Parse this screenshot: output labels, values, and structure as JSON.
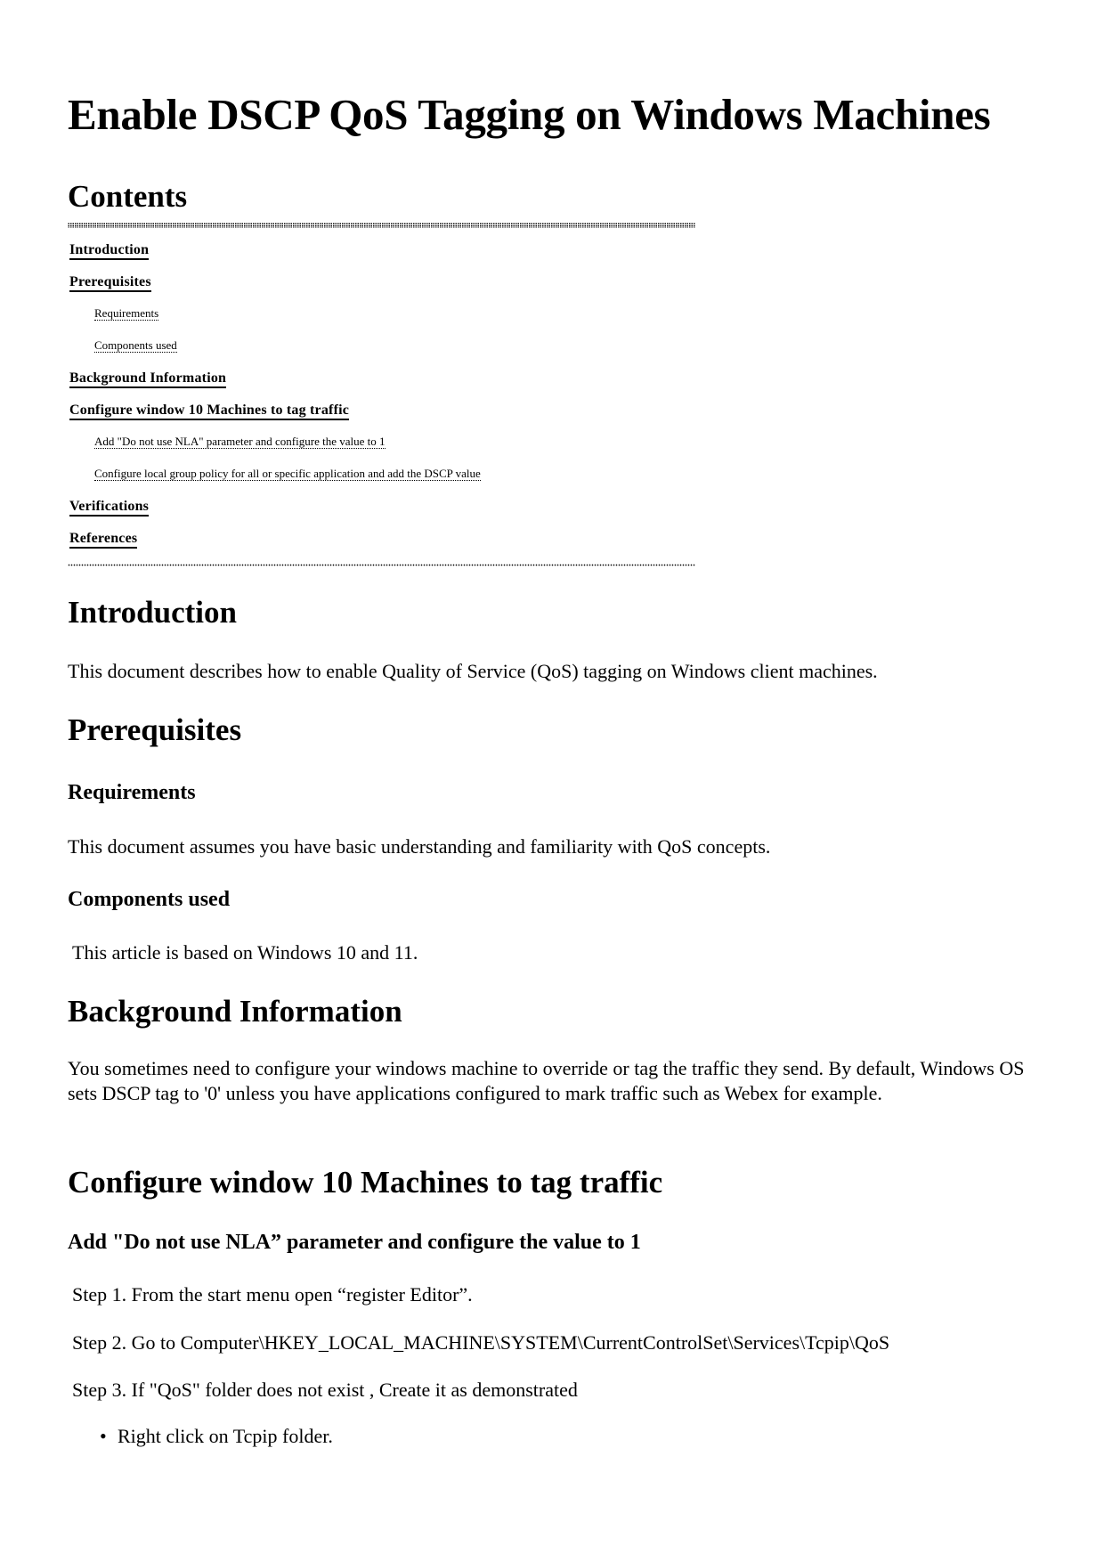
{
  "title": "Enable DSCP QoS Tagging on Windows Machines",
  "contents": {
    "heading": "Contents",
    "items": [
      {
        "label": "Introduction",
        "level": 1
      },
      {
        "label": "Prerequisites",
        "level": 1
      },
      {
        "label": "Requirements",
        "level": 2
      },
      {
        "label": "Components used",
        "level": 2
      },
      {
        "label": "Background Information",
        "level": 1
      },
      {
        "label": "Configure window 10 Machines to tag traffic",
        "level": 1
      },
      {
        "label": "Add \"Do not use NLA\" parameter and configure the value to 1",
        "level": 2
      },
      {
        "label": "Configure local group policy for all or specific application and add the DSCP value",
        "level": 2
      },
      {
        "label": "Verifications",
        "level": 1
      },
      {
        "label": "References",
        "level": 1
      }
    ]
  },
  "sections": {
    "introduction": {
      "heading": "Introduction",
      "body": "This document describes how to enable Quality of Service (QoS) tagging on Windows client machines."
    },
    "prerequisites": {
      "heading": "Prerequisites",
      "requirements": {
        "heading": "Requirements",
        "body": "This document assumes you have basic understanding and familiarity with QoS concepts."
      },
      "components": {
        "heading": "Components used",
        "body": "This article is based on Windows 10 and 11."
      }
    },
    "background": {
      "heading": "Background Information",
      "body": "You sometimes need to configure your windows machine to override or tag the traffic they send. By default, Windows OS sets DSCP tag to '0' unless you have applications configured to mark traffic such as Webex for example."
    },
    "configure": {
      "heading": "Configure window 10 Machines to tag traffic",
      "nla": {
        "heading": "Add \"Do not use NLA” parameter and configure the value to 1",
        "steps": [
          "Step 1. From the start menu open “register Editor”.",
          "Step 2. Go to  Computer\\HKEY_LOCAL_MACHINE\\SYSTEM\\CurrentControlSet\\Services\\Tcpip\\QoS",
          "Step 3. If \"QoS\" folder does not exist , Create it as demonstrated"
        ],
        "bullets": [
          "Right click on Tcpip folder."
        ]
      }
    }
  }
}
